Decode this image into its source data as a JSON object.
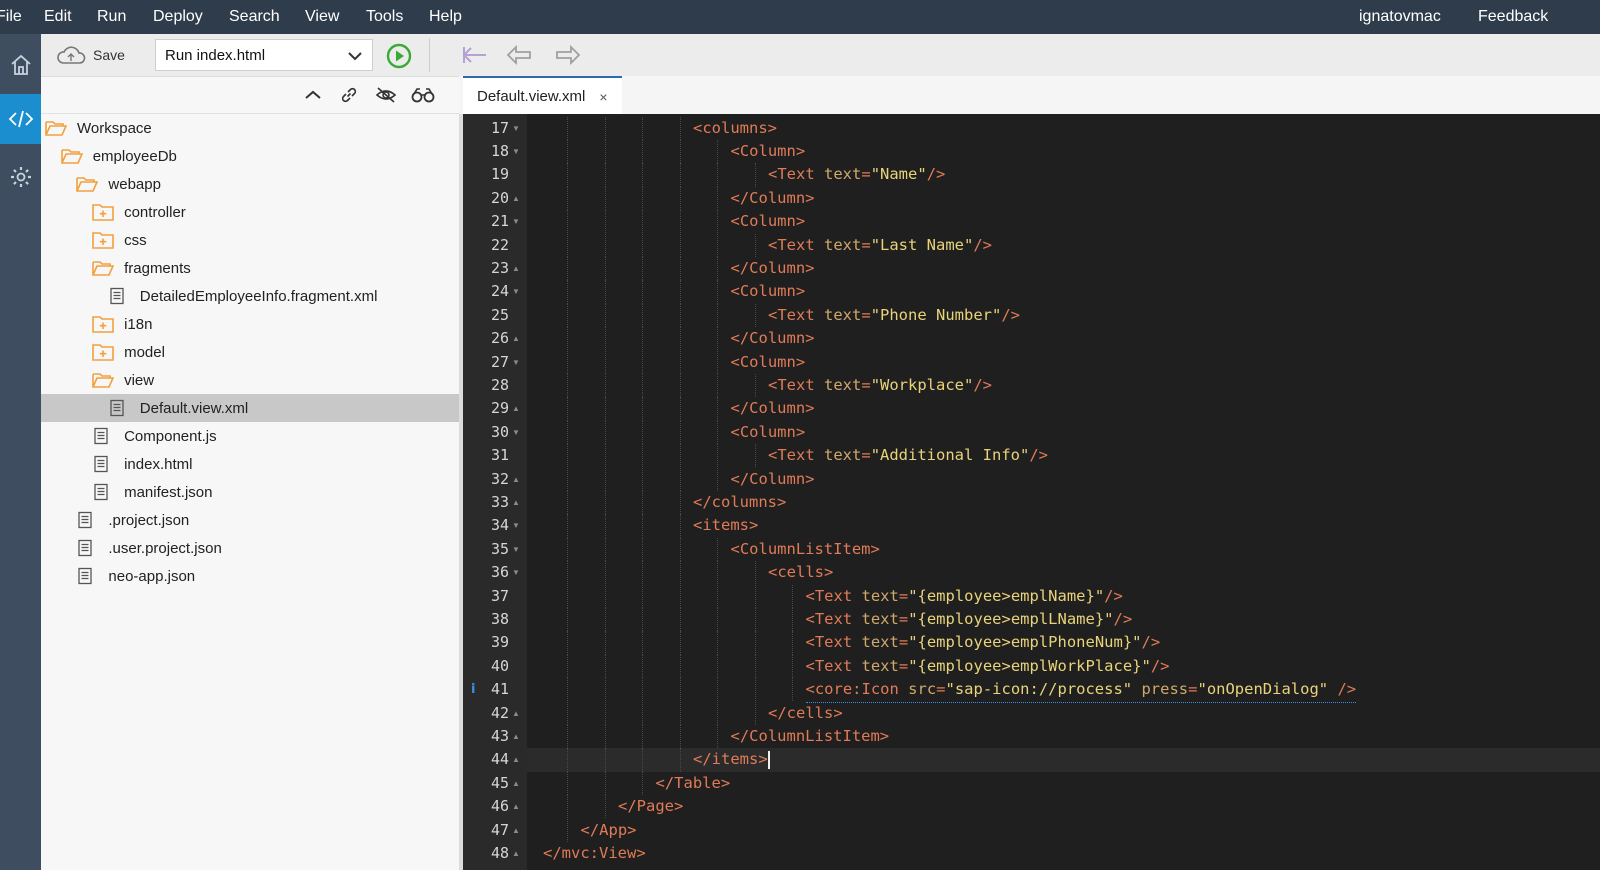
{
  "menu": {
    "items": [
      "File",
      "Edit",
      "Run",
      "Deploy",
      "Search",
      "View",
      "Tools",
      "Help"
    ],
    "user": "ignatovmac",
    "feedback": "Feedback"
  },
  "activity": {
    "icons": [
      "home-icon",
      "code-icon",
      "gear-icon"
    ]
  },
  "toolbar": {
    "save_label": "Save",
    "run_select_value": "Run index.html"
  },
  "tree": {
    "items": [
      {
        "label": "Workspace",
        "type": "folder-open",
        "depth": 0
      },
      {
        "label": "employeeDb",
        "type": "folder-open",
        "depth": 1
      },
      {
        "label": "webapp",
        "type": "folder-open",
        "depth": 2
      },
      {
        "label": "controller",
        "type": "folder-closed",
        "depth": 3
      },
      {
        "label": "css",
        "type": "folder-closed",
        "depth": 3
      },
      {
        "label": "fragments",
        "type": "folder-open",
        "depth": 3
      },
      {
        "label": "DetailedEmployeeInfo.fragment.xml",
        "type": "file",
        "depth": 4
      },
      {
        "label": "i18n",
        "type": "folder-closed",
        "depth": 3
      },
      {
        "label": "model",
        "type": "folder-closed",
        "depth": 3
      },
      {
        "label": "view",
        "type": "folder-open",
        "depth": 3
      },
      {
        "label": "Default.view.xml",
        "type": "file",
        "depth": 4,
        "selected": true
      },
      {
        "label": "Component.js",
        "type": "file",
        "depth": 3
      },
      {
        "label": "index.html",
        "type": "file",
        "depth": 3
      },
      {
        "label": "manifest.json",
        "type": "file",
        "depth": 3
      },
      {
        "label": ".project.json",
        "type": "file",
        "depth": 2
      },
      {
        "label": ".user.project.json",
        "type": "file",
        "depth": 2
      },
      {
        "label": "neo-app.json",
        "type": "file",
        "depth": 2
      }
    ]
  },
  "editor": {
    "tab_label": "Default.view.xml",
    "tab_close": "×",
    "lines": [
      {
        "n": "17",
        "fold": "down",
        "indent": 4,
        "code": "<columns>"
      },
      {
        "n": "18",
        "fold": "down",
        "indent": 5,
        "code": "<Column>"
      },
      {
        "n": "19",
        "fold": "",
        "indent": 6,
        "code": "<Text text=\"Name\"/>"
      },
      {
        "n": "20",
        "fold": "up",
        "indent": 5,
        "code": "</Column>"
      },
      {
        "n": "21",
        "fold": "down",
        "indent": 5,
        "code": "<Column>"
      },
      {
        "n": "22",
        "fold": "",
        "indent": 6,
        "code": "<Text text=\"Last Name\"/>"
      },
      {
        "n": "23",
        "fold": "up",
        "indent": 5,
        "code": "</Column>"
      },
      {
        "n": "24",
        "fold": "down",
        "indent": 5,
        "code": "<Column>"
      },
      {
        "n": "25",
        "fold": "",
        "indent": 6,
        "code": "<Text text=\"Phone Number\"/>"
      },
      {
        "n": "26",
        "fold": "up",
        "indent": 5,
        "code": "</Column>"
      },
      {
        "n": "27",
        "fold": "down",
        "indent": 5,
        "code": "<Column>"
      },
      {
        "n": "28",
        "fold": "",
        "indent": 6,
        "code": "<Text text=\"Workplace\"/>"
      },
      {
        "n": "29",
        "fold": "up",
        "indent": 5,
        "code": "</Column>"
      },
      {
        "n": "30",
        "fold": "down",
        "indent": 5,
        "code": "<Column>"
      },
      {
        "n": "31",
        "fold": "",
        "indent": 6,
        "code": "<Text text=\"Additional Info\"/>"
      },
      {
        "n": "32",
        "fold": "up",
        "indent": 5,
        "code": "</Column>"
      },
      {
        "n": "33",
        "fold": "up",
        "indent": 4,
        "code": "</columns>"
      },
      {
        "n": "34",
        "fold": "down",
        "indent": 4,
        "code": "<items>"
      },
      {
        "n": "35",
        "fold": "down",
        "indent": 5,
        "code": "<ColumnListItem>"
      },
      {
        "n": "36",
        "fold": "down",
        "indent": 6,
        "code": "<cells>"
      },
      {
        "n": "37",
        "fold": "",
        "indent": 7,
        "code": "<Text text=\"{employee>emplName}\"/>"
      },
      {
        "n": "38",
        "fold": "",
        "indent": 7,
        "code": "<Text text=\"{employee>emplLName}\"/>"
      },
      {
        "n": "39",
        "fold": "",
        "indent": 7,
        "code": "<Text text=\"{employee>emplPhoneNum}\"/>"
      },
      {
        "n": "40",
        "fold": "",
        "indent": 7,
        "code": "<Text text=\"{employee>emplWorkPlace}\"/>"
      },
      {
        "n": "41",
        "fold": "",
        "indent": 7,
        "code": "<core:Icon src=\"sap-icon://process\" press=\"onOpenDialog\" />",
        "info": "i"
      },
      {
        "n": "42",
        "fold": "up",
        "indent": 6,
        "code": "</cells>"
      },
      {
        "n": "43",
        "fold": "up",
        "indent": 5,
        "code": "</ColumnListItem>"
      },
      {
        "n": "44",
        "fold": "up",
        "indent": 4,
        "code": "</items>",
        "cursor": true
      },
      {
        "n": "45",
        "fold": "up",
        "indent": 3,
        "code": "</Table>"
      },
      {
        "n": "46",
        "fold": "up",
        "indent": 2,
        "code": "</Page>"
      },
      {
        "n": "47",
        "fold": "up",
        "indent": 1,
        "code": "</App>"
      },
      {
        "n": "48",
        "fold": "up",
        "indent": 0,
        "code": "</mvc:View>"
      }
    ]
  },
  "colors": {
    "menubar": "#2f3c4b",
    "activity_active": "#1b8ecf",
    "folder": "#f2a03d",
    "run_green": "#3aaa35"
  }
}
